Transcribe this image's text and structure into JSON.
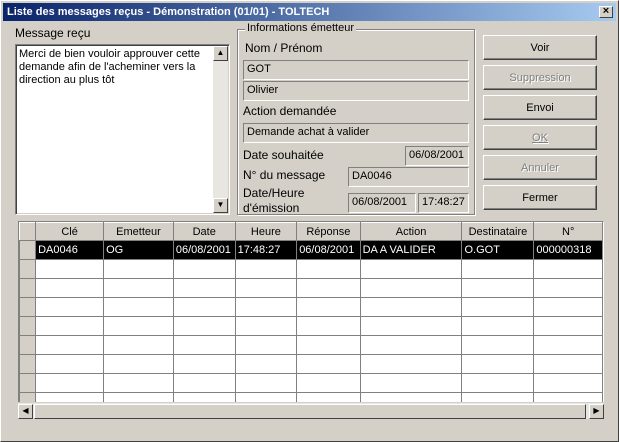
{
  "window": {
    "title": "Liste des messages reçus - Démonstration (01/01) - TOLTECH",
    "close_label": "×"
  },
  "message": {
    "label": "Message reçu",
    "text": "Merci de bien vouloir approuver cette\ndemande afin de l'acheminer vers la\ndirection au plus tôt"
  },
  "sender": {
    "group_title": "Informations émetteur",
    "name_label": "Nom / Prénom",
    "last_name": "GOT",
    "first_name": "Olivier",
    "action_label": "Action demandée",
    "action_value": "Demande achat à valider",
    "date_label": "Date souhaitée",
    "date_value": "06/08/2001",
    "msgno_label": "N° du message",
    "msgno_value": "DA0046",
    "emission_label_1": "Date/Heure",
    "emission_label_2": "d'émission",
    "emission_date": "06/08/2001",
    "emission_time": "17:48:27"
  },
  "buttons": {
    "voir": "Voir",
    "suppression": "Suppression",
    "envoi": "Envoi",
    "ok": "OK",
    "annuler": "Annuler",
    "fermer": "Fermer"
  },
  "grid": {
    "columns": [
      "Clé",
      "Emetteur",
      "Date",
      "Heure",
      "Réponse",
      "Action",
      "Destinataire",
      "N°"
    ],
    "rows": [
      [
        "DA0046",
        "OG",
        "06/08/2001",
        "17:48:27",
        "06/08/2001",
        "DA A VALIDER",
        "O.GOT",
        "000000318"
      ]
    ]
  }
}
